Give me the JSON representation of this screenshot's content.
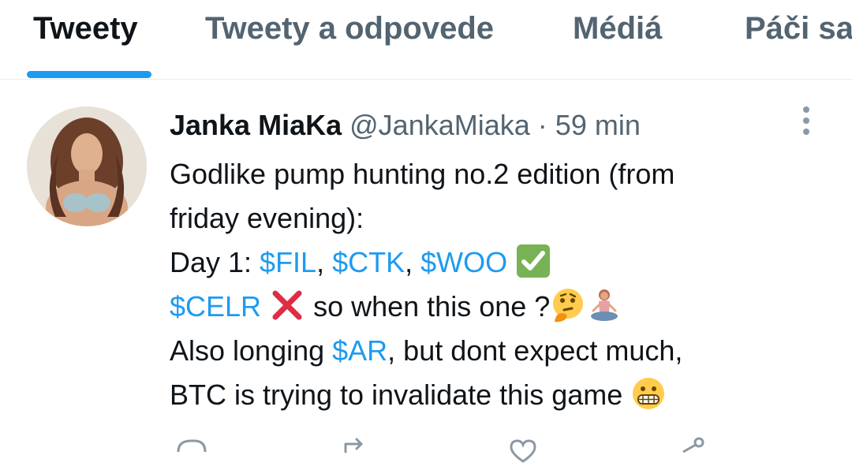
{
  "tabs": [
    {
      "label": "Tweety",
      "active": true
    },
    {
      "label": "Tweety a odpovede",
      "active": false
    },
    {
      "label": "Médiá",
      "active": false
    },
    {
      "label": "Páči sa",
      "active": false
    }
  ],
  "colors": {
    "accent": "#1d9bf0",
    "text": "#0f1419",
    "muted": "#536471",
    "check_green": "#77b255",
    "cross_red": "#dd2e44"
  },
  "tweet": {
    "author_name": "Janka MiaKa",
    "handle": "@JankaMiaka",
    "separator": "·",
    "time": "59 min",
    "lines": {
      "l1": "Godlike pump hunting no.2 edition (from",
      "l2": "friday evening):",
      "l3_prefix": "Day 1: ",
      "cash_fil": "$FIL",
      "comma1": ", ",
      "cash_ctk": "$CTK",
      "comma2": ", ",
      "cash_woo": "$WOO",
      "cash_celr": "$CELR",
      "l4_text": " so when this one ?",
      "l5_prefix": "Also longing ",
      "cash_ar": "$AR",
      "l5_suffix": ", but dont expect much,",
      "l6": "BTC is trying to invalidate this game "
    },
    "emojis": [
      "check-mark-button",
      "cross-mark",
      "thinking-face",
      "woman-in-lotus-position",
      "grimacing-face"
    ]
  },
  "actions": [
    "reply-icon",
    "retweet-icon",
    "like-icon",
    "share-icon"
  ]
}
